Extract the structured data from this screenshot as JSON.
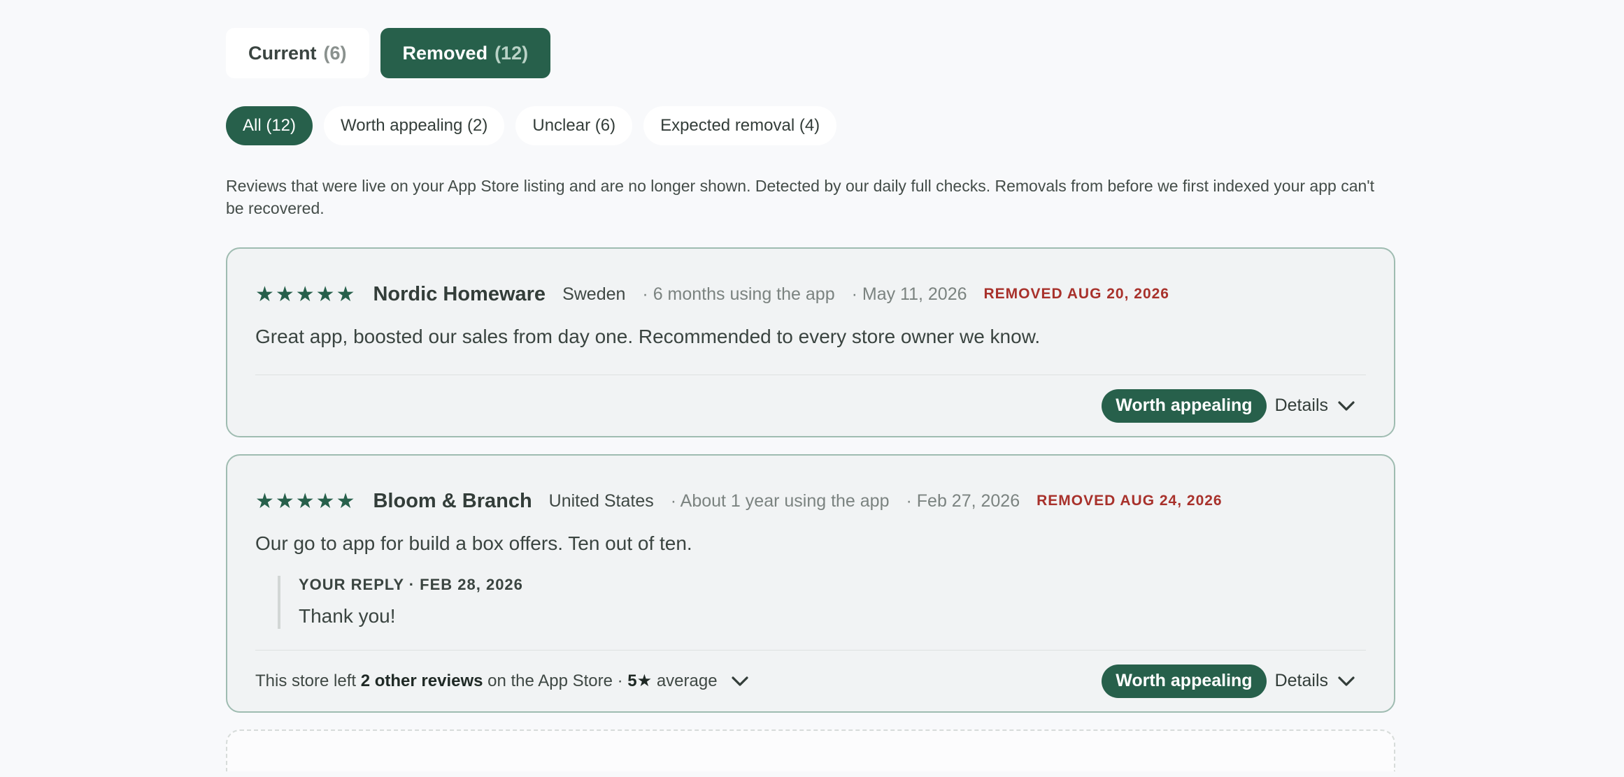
{
  "tabs": [
    {
      "label": "Current",
      "count": "(6)"
    },
    {
      "label": "Removed",
      "count": "(12)"
    }
  ],
  "filters": [
    {
      "label": "All (12)"
    },
    {
      "label": "Worth appealing (2)"
    },
    {
      "label": "Unclear (6)"
    },
    {
      "label": "Expected removal (4)"
    }
  ],
  "description": "Reviews that were live on your App Store listing and are no longer shown. Detected by our daily full checks. Removals from before we first indexed your app can't be recovered.",
  "reviews": [
    {
      "stars": "★★★★★",
      "store": "Nordic Homeware",
      "country": "Sweden",
      "usage": "· 6 months using the app",
      "date": "· May 11, 2026",
      "removed": "REMOVED AUG 20, 2026",
      "text": "Great app, boosted our sales from day one. Recommended to every store owner we know.",
      "badge": "Worth appealing",
      "details": "Details"
    },
    {
      "stars": "★★★★★",
      "store": "Bloom & Branch",
      "country": "United States",
      "usage": "· About 1 year using the app",
      "date": "· Feb 27, 2026",
      "removed": "REMOVED AUG 24, 2026",
      "text": "Our go to app for build a box offers. Ten out of ten.",
      "reply_label": "YOUR REPLY · FEB 28, 2026",
      "reply_text": "Thank you!",
      "footer_prefix": "This store left ",
      "footer_bold": "2 other reviews",
      "footer_mid": " on the App Store · ",
      "footer_rating": "5★",
      "footer_suffix": " average",
      "badge": "Worth appealing",
      "details": "Details"
    }
  ]
}
